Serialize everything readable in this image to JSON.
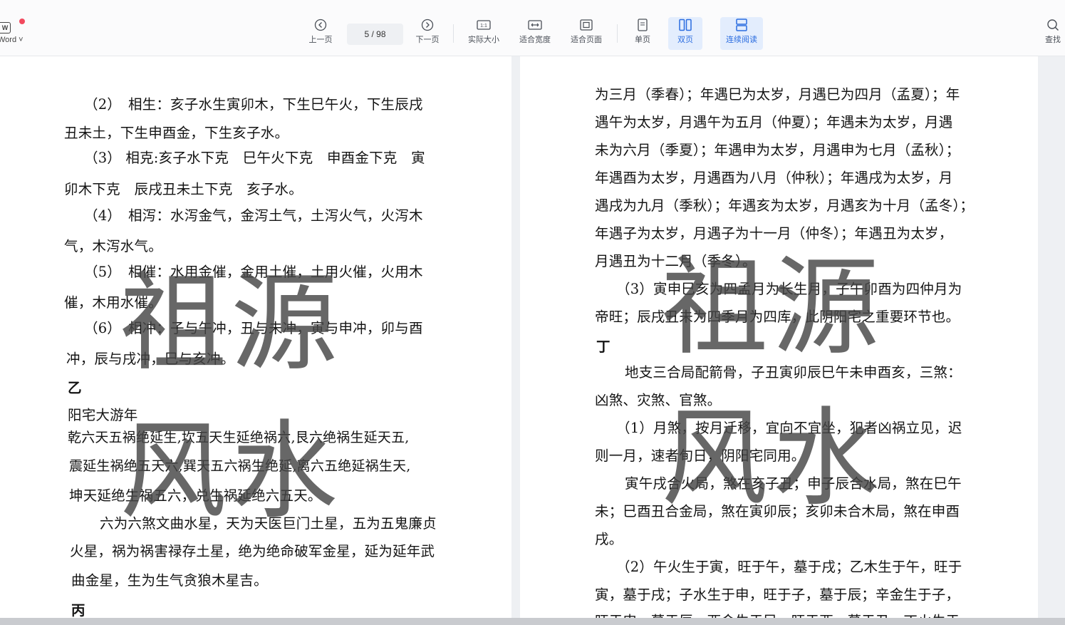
{
  "app": {
    "label": "Word ˅",
    "logo_letter": "W"
  },
  "toolbar": {
    "prev_label": "上一页",
    "page_indicator": "5 / 98",
    "next_label": "下一页",
    "actual_size_label": "实际大小",
    "fit_width_label": "适合宽度",
    "fit_page_label": "适合页面",
    "single_page_label": "单页",
    "double_page_label": "双页",
    "continuous_label": "连续阅读",
    "search_label": "查找"
  },
  "watermark": {
    "line1": "祖源",
    "line2": "风水"
  },
  "left_page": {
    "lines": [
      "（2）　相生：亥子水生寅卯木，下生巳午火，下生辰戌",
      "丑未土，下生申酉金，下生亥子水。",
      "（3） 相克:亥子水下克　巳午火下克　申酉金下克　寅",
      "卯木下克　辰戌丑未土下克　亥子水。",
      "（4）　相泻：水泻金气，金泻土气，土泻火气，火泻木",
      "气，木泻水气。",
      "（5）　相催：水用金催，金用土催，土用火催，火用木",
      "催，木用水催。",
      "（6）　相冲：子与午冲，丑与未冲，寅与申冲，卯与酉",
      "冲，辰与戌冲，巳与亥冲。",
      "乙",
      "阳宅大游年",
      "乾六天五祸绝延生,坎五天生延绝祸六,艮六绝祸生延天五,",
      "震延生祸绝五天六,巽天五六祸生绝延,离六五绝延祸生天,",
      "坤天延绝生祸五六，兑生祸延绝六五天。",
      "六为六煞文曲水星，天为天医巨门土星，五为五鬼廉贞",
      "火星，祸为祸害禄存土星，绝为绝命破军金星，延为延年武",
      "曲金星，生为生气贪狼木星吉。",
      "丙"
    ]
  },
  "right_page": {
    "lines": [
      "为三月（季春）；年遇巳为太岁，月遇巳为四月（孟夏）；年",
      "遇午为太岁，月遇午为五月（仲夏）；年遇未为太岁，月遇",
      "未为六月（季夏）；年遇申为太岁，月遇申为七月（孟秋）；",
      "年遇酉为太岁，月遇酉为八月（仲秋）；年遇戌为太岁，月",
      "遇戌为九月（季秋）；年遇亥为太岁，月遇亥为十月（孟冬）；",
      "年遇子为太岁，月遇子为十一月（仲冬）；年遇丑为太岁，",
      "月遇丑为十二月（季冬）。",
      "（3）寅申巳亥为四孟月为长生月，子午卯酉为四仲月为",
      "帝旺；辰戌丑未为四季月为四库，此阴阳宅之重要环节也。",
      "丁",
      "地支三合局配箭骨，子丑寅卯辰巳午未申酉亥，三煞：",
      "凶煞、灾煞、官煞。",
      "（1）月煞，按月迁移，宜向不宜坐，犯者凶祸立见，迟",
      "则一月，速者旬日，阴阳宅同用。",
      "寅午戌合火局，煞在亥子丑；申子辰合水局，煞在巳午",
      "未；巳酉丑合金局，煞在寅卯辰；亥卯未合木局，煞在申酉",
      "戌。",
      "（2）午火生于寅，旺于午，墓于戌；乙木生于午，旺于",
      "寅，墓于戌；子水生于申，旺于子，墓于辰；辛金生于子，",
      "旺于申，墓于辰，酉金生于巳，旺于酉，墓于丑，丁火生于"
    ]
  }
}
